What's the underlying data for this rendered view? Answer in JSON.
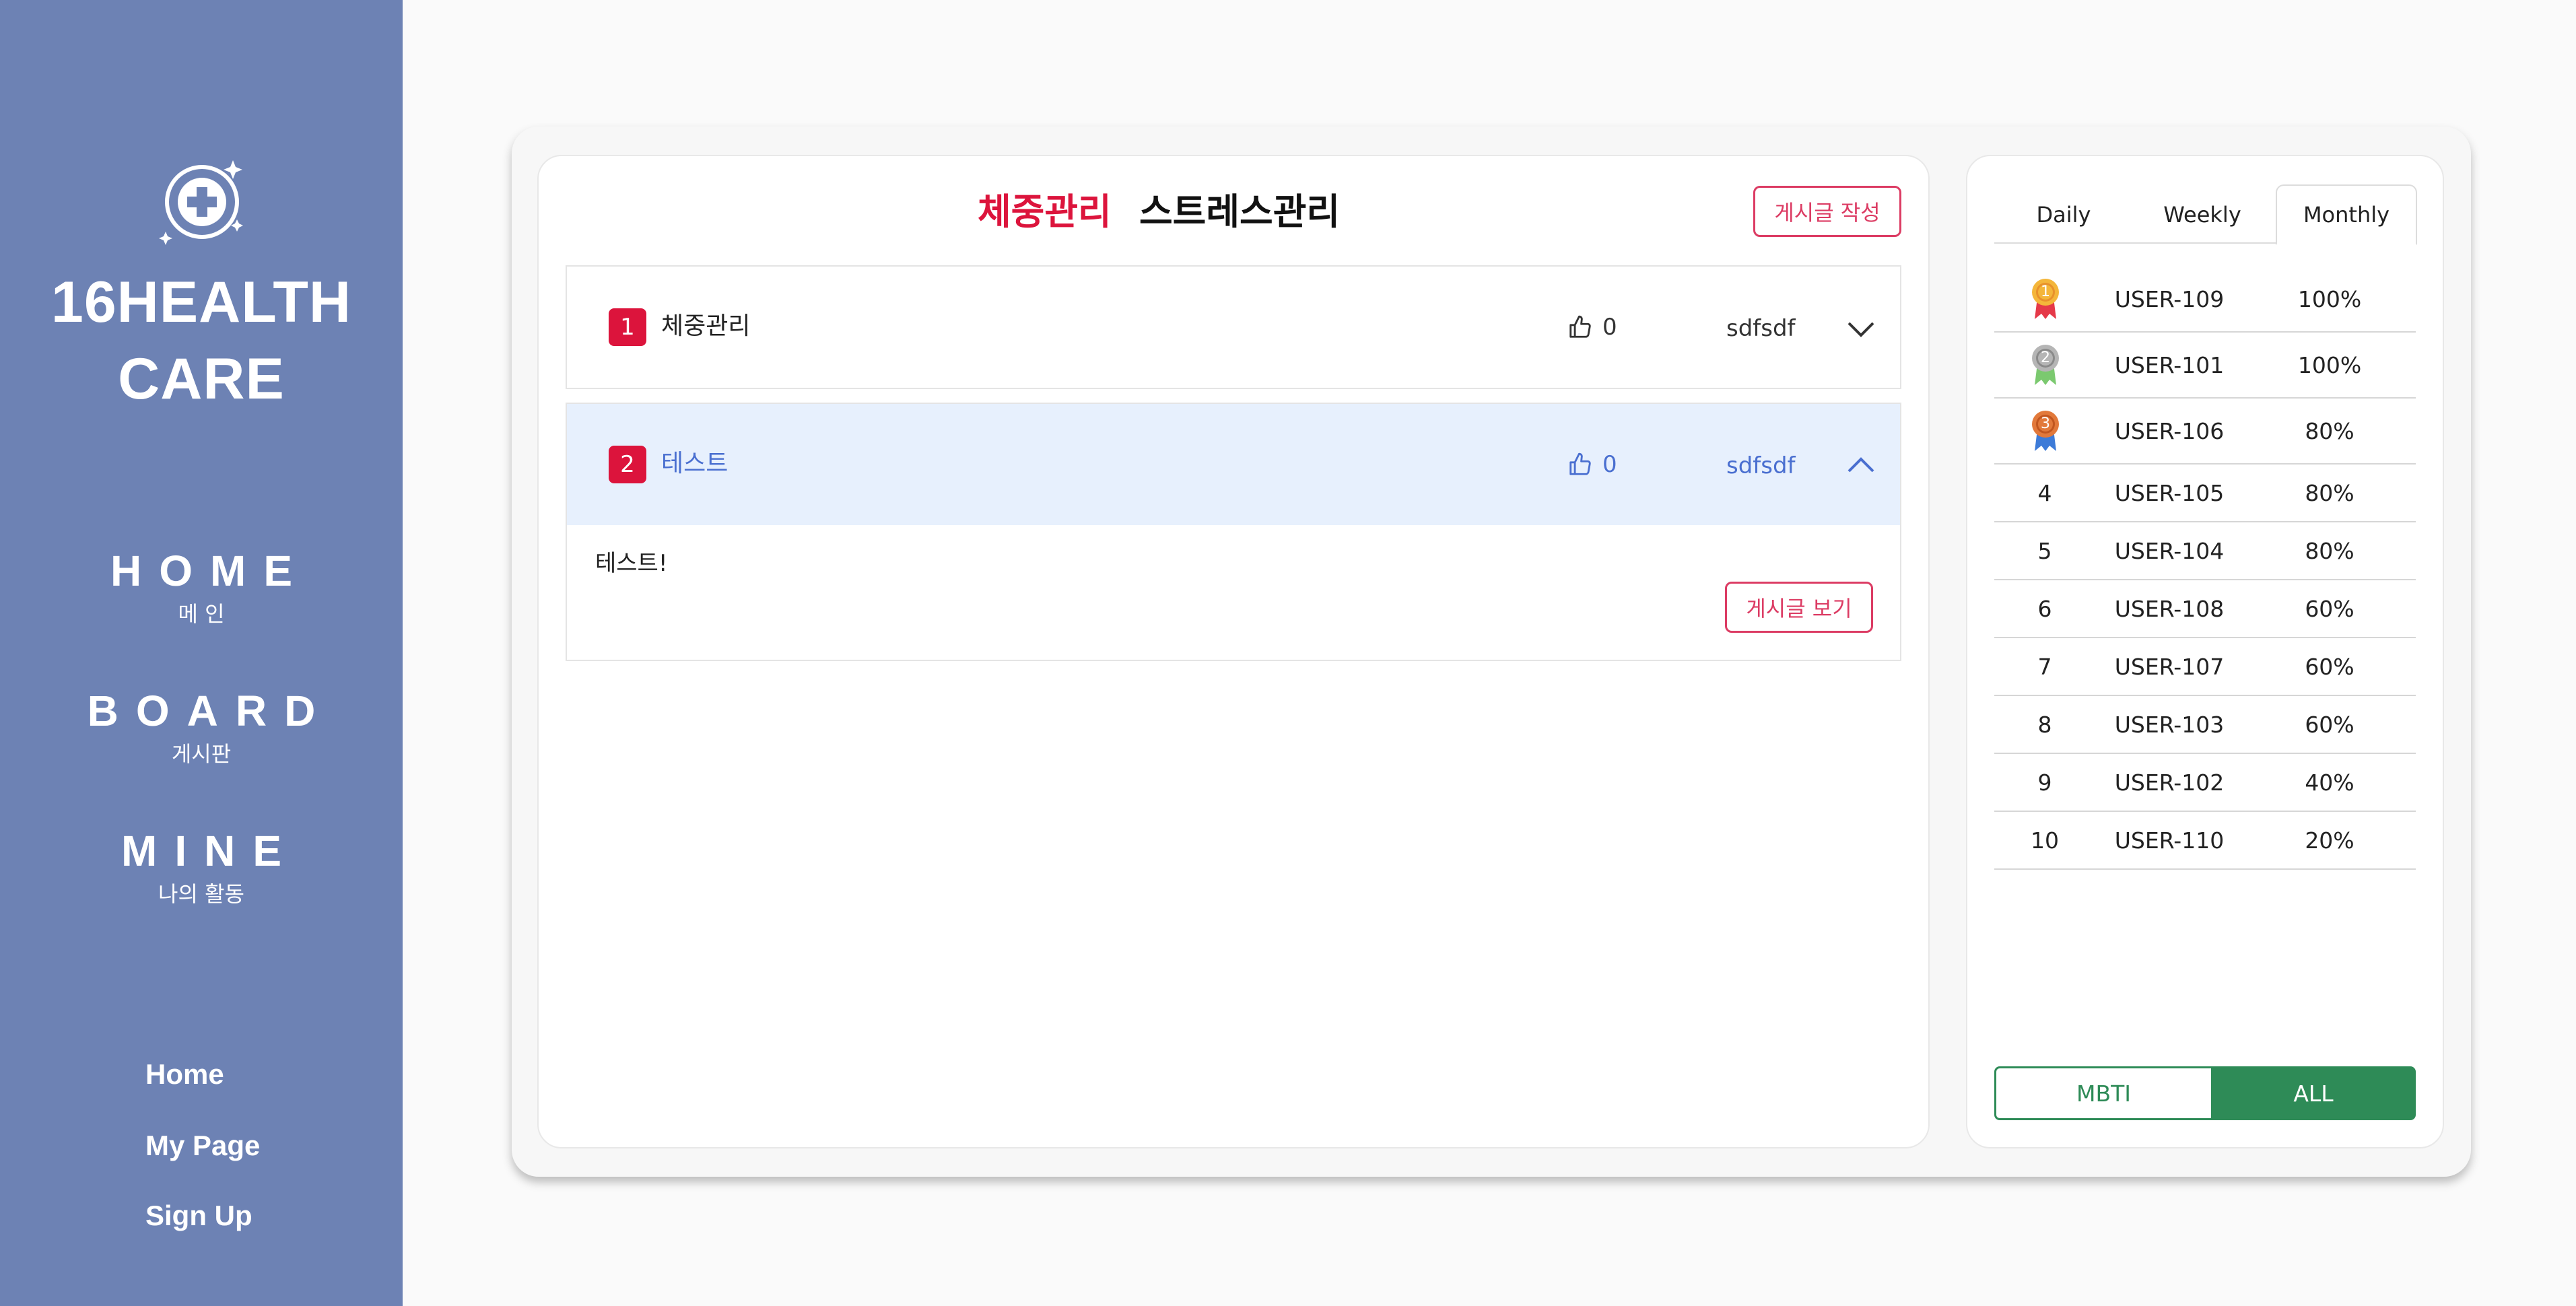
{
  "sidebar": {
    "logo_line1": "16HEALTH",
    "logo_line2": "CARE",
    "nav": [
      {
        "main": "HOME",
        "sub": "메 인"
      },
      {
        "main": "BOARD",
        "sub": "게시판"
      },
      {
        "main": "MINE",
        "sub": "나의 활동"
      }
    ],
    "links": [
      "Home",
      "My Page",
      "Sign Up"
    ],
    "bg_color": "#6d82b4"
  },
  "board": {
    "tabs": [
      {
        "label": "체중관리",
        "active": true
      },
      {
        "label": "스트레스관리",
        "active": false
      }
    ],
    "write_button": "게시글 작성",
    "posts": [
      {
        "number": "1",
        "title": "체중관리",
        "likes": "0",
        "author": "sdfsdf",
        "expanded": false
      },
      {
        "number": "2",
        "title": "테스트",
        "likes": "0",
        "author": "sdfsdf",
        "expanded": true
      }
    ],
    "expanded_body": "테스트!",
    "view_button": "게시글 보기",
    "accent_color": "#dc143c"
  },
  "ranking": {
    "tabs": [
      {
        "label": "Daily",
        "active": false
      },
      {
        "label": "Weekly",
        "active": false
      },
      {
        "label": "Monthly",
        "active": true
      }
    ],
    "rows": [
      {
        "rank": "1",
        "user": "USER-109",
        "percent": "100%",
        "medal": "gold-medal-icon"
      },
      {
        "rank": "2",
        "user": "USER-101",
        "percent": "100%",
        "medal": "silver-medal-icon"
      },
      {
        "rank": "3",
        "user": "USER-106",
        "percent": "80%",
        "medal": "bronze-medal-icon"
      },
      {
        "rank": "4",
        "user": "USER-105",
        "percent": "80%"
      },
      {
        "rank": "5",
        "user": "USER-104",
        "percent": "80%"
      },
      {
        "rank": "6",
        "user": "USER-108",
        "percent": "60%"
      },
      {
        "rank": "7",
        "user": "USER-107",
        "percent": "60%"
      },
      {
        "rank": "8",
        "user": "USER-103",
        "percent": "60%"
      },
      {
        "rank": "9",
        "user": "USER-102",
        "percent": "40%"
      },
      {
        "rank": "10",
        "user": "USER-110",
        "percent": "20%"
      }
    ],
    "filter": {
      "mbti": "MBTI",
      "all": "ALL",
      "selected": "ALL"
    },
    "green_color": "#2e8b57"
  }
}
